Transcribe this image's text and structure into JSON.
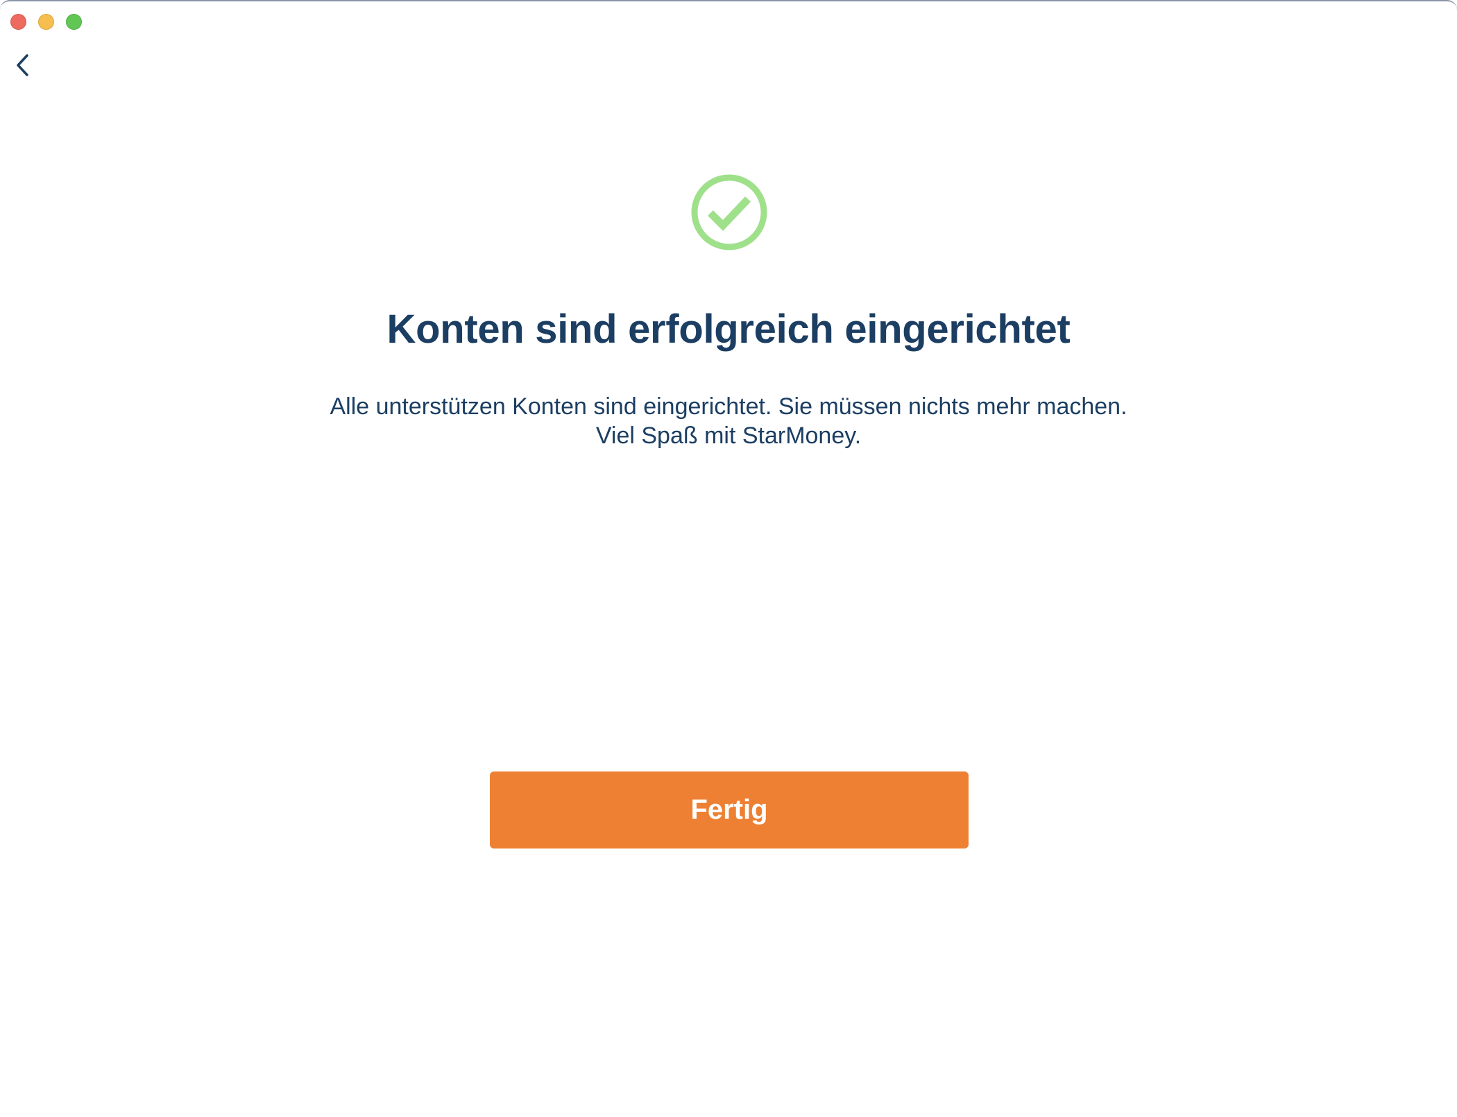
{
  "window": {
    "controls": [
      "close",
      "minimize",
      "zoom"
    ],
    "colors": {
      "close": "#ee6a5f",
      "minimize": "#f5be4f",
      "zoom": "#62c655"
    }
  },
  "navigation": {
    "back_icon": "chevron-left-icon"
  },
  "status": {
    "icon": "check-circle-icon",
    "icon_color": "#9fe08b"
  },
  "main": {
    "title": "Konten sind erfolgreich eingerichtet",
    "message_line1": "Alle unterstützen Konten sind eingerichtet. Sie müssen nichts mehr machen.",
    "message_line2": "Viel Spaß mit StarMoney.",
    "text_color": "#1c3e62"
  },
  "actions": {
    "done_label": "Fertig",
    "done_color": "#ee8033"
  }
}
